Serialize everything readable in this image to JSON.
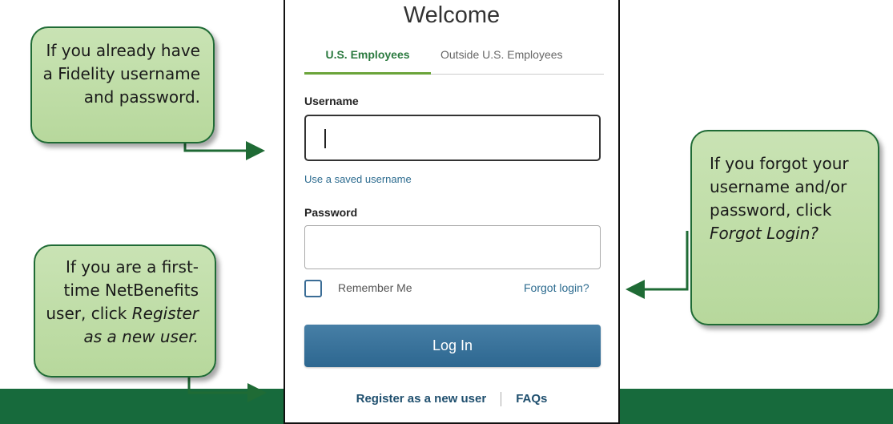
{
  "colors": {
    "bar": "#176a3c",
    "callout_fill": "#b7d89c",
    "callout_border": "#1f6b35",
    "button": "#2d6790",
    "tab_active": "#2b7a3f"
  },
  "login": {
    "title": "Welcome",
    "tabs": [
      {
        "label": "U.S. Employees",
        "active": true
      },
      {
        "label": "Outside U.S. Employees",
        "active": false
      }
    ],
    "username_label": "Username",
    "username_value": "",
    "saved_username_link": "Use a saved username",
    "password_label": "Password",
    "password_value": "",
    "remember_label": "Remember Me",
    "remember_checked": false,
    "forgot_link": "Forgot login?",
    "login_button": "Log In",
    "register_link": "Register as a new user",
    "faqs_link": "FAQs"
  },
  "callouts": {
    "existing_user": {
      "text": "If you already have a Fidelity username and password."
    },
    "new_user": {
      "text_before": "If you are a first-time NetBenefits user, click ",
      "emphasis": "Register as a new user."
    },
    "forgot": {
      "text_before": "If you forgot your username and/or password, click ",
      "emphasis": "Forgot Login?"
    }
  }
}
